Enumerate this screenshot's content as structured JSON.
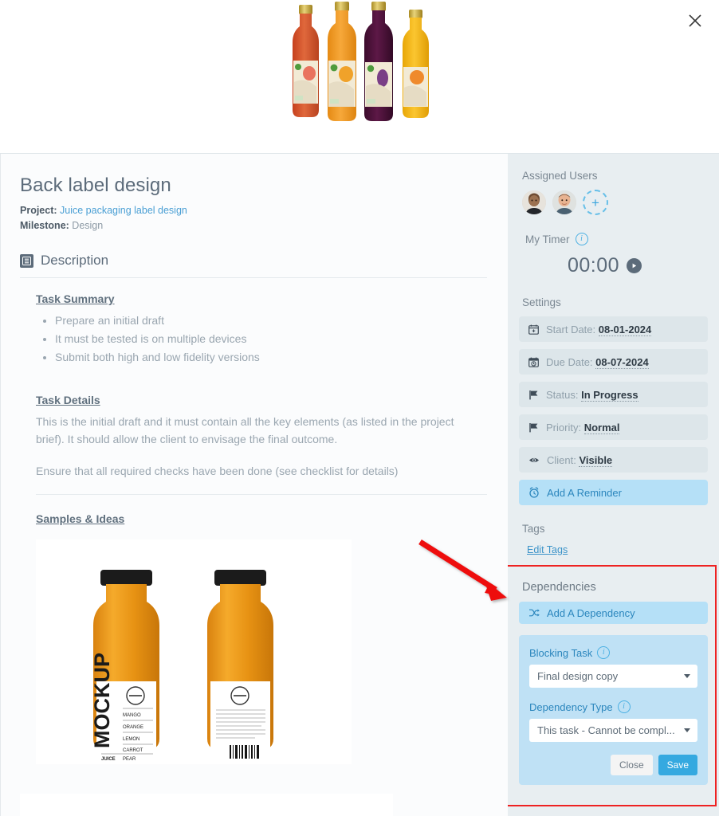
{
  "modal": {
    "close_icon": "close-icon",
    "hero_image_alt": "Four juice bottles product photo"
  },
  "main": {
    "title": "Back label design",
    "project_label": "Project:",
    "project_value": "Juice packaging label design",
    "milestone_label": "Milestone:",
    "milestone_value": "Design",
    "description_heading": "Description",
    "description_icon": "document-icon",
    "task_summary_heading": "Task Summary",
    "task_summary_items": [
      "Prepare an initial draft",
      "It must be tested is on multiple devices",
      "Submit both high and low fidelity versions"
    ],
    "task_details_heading": "Task Details",
    "task_details_paragraphs": [
      "This is the initial draft and it must contain all the key elements (as listed in the project brief). It should allow the client to envisage the final outcome.",
      "Ensure that all required checks have been done (see checklist for details)"
    ],
    "samples_heading": "Samples & Ideas",
    "sample_image_alt": "Two orange juice bottle mockups front and back"
  },
  "sidebar": {
    "assigned_users_label": "Assigned Users",
    "add_user_symbol": "+",
    "timer_label": "My Timer",
    "timer_value": "00:00",
    "timer_play_icon": "play-icon",
    "settings_label": "Settings",
    "settings": [
      {
        "icon": "calendar-icon",
        "label": "Start Date:",
        "value": "08-01-2024"
      },
      {
        "icon": "calendar-clock-icon",
        "label": "Due Date:",
        "value": "08-07-2024"
      },
      {
        "icon": "flag-icon",
        "label": "Status:",
        "value": "In Progress"
      },
      {
        "icon": "flag-icon",
        "label": "Priority:",
        "value": "Normal"
      },
      {
        "icon": "eye-icon",
        "label": "Client:",
        "value": "Visible"
      }
    ],
    "add_reminder_label": "Add A Reminder",
    "add_reminder_icon": "alarm-clock-icon",
    "tags_label": "Tags",
    "edit_tags_label": "Edit Tags",
    "dependencies": {
      "title": "Dependencies",
      "add_dependency_label": "Add A Dependency",
      "add_dependency_icon": "shuffle-icon",
      "blocking_task_label": "Blocking Task",
      "blocking_task_value": "Final design copy",
      "dependency_type_label": "Dependency Type",
      "dependency_type_value": "This task - Cannot be compl...",
      "close_button": "Close",
      "save_button": "Save"
    }
  },
  "annotation": {
    "arrow_color": "#ee1111",
    "highlight_color": "#ee2222"
  },
  "colors": {
    "accent_blue": "#35a9e0",
    "link_blue": "#4a9fd4",
    "sidebar_bg": "#e8eef1",
    "setting_row_bg": "#dde6ea",
    "highlight_row_bg": "#b5e0f7",
    "text_gray": "#5c6b7a"
  }
}
